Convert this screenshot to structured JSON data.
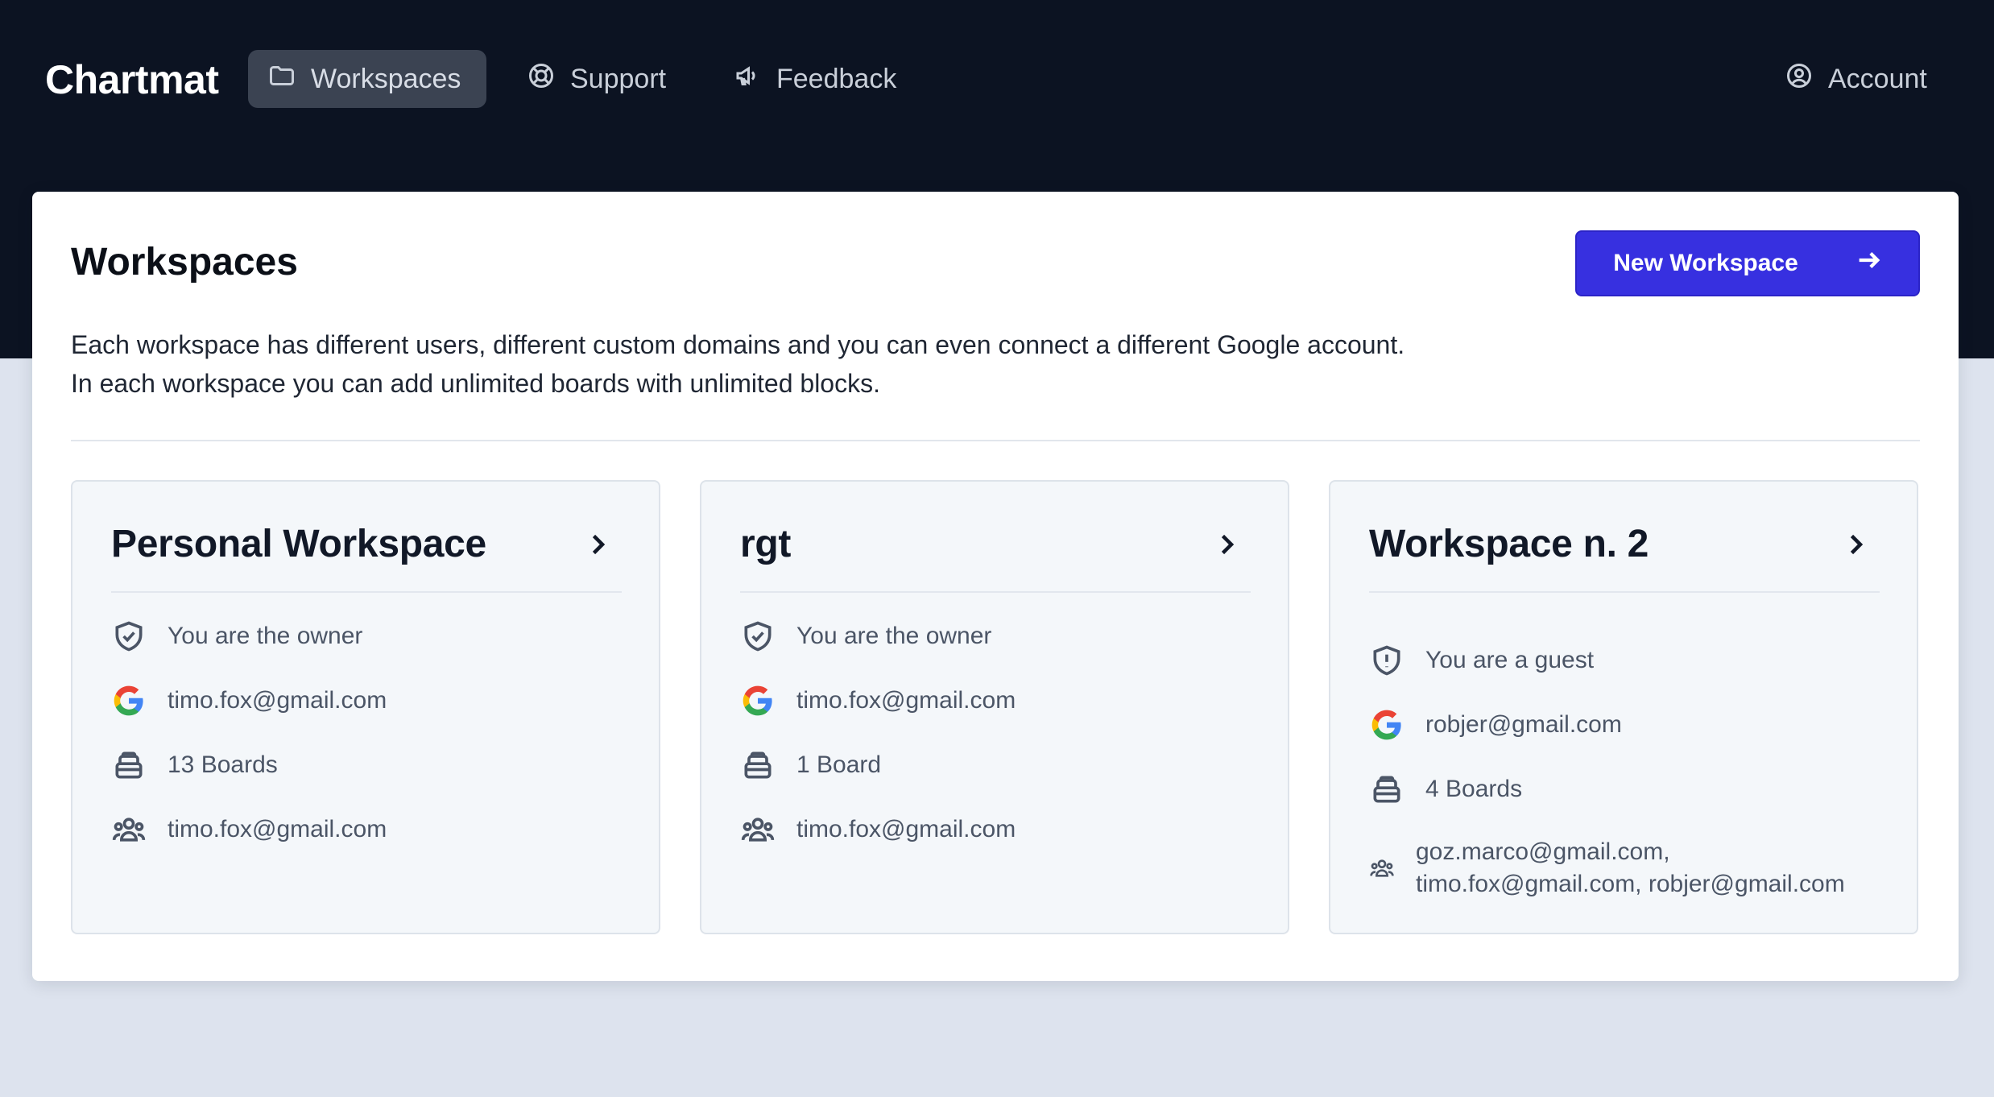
{
  "brand": "Chartmat",
  "nav": {
    "workspaces": "Workspaces",
    "support": "Support",
    "feedback": "Feedback",
    "account": "Account"
  },
  "panel": {
    "title": "Workspaces",
    "new_button": "New Workspace",
    "description_line1": "Each workspace has different users, different custom domains and you can even connect a different Google account.",
    "description_line2": "In each workspace you can add unlimited boards with unlimited blocks."
  },
  "cards": [
    {
      "title": "Personal Workspace",
      "role": "You are the owner",
      "google": "timo.fox@gmail.com",
      "boards": "13 Boards",
      "members_line1": "timo.fox@gmail.com"
    },
    {
      "title": "rgt",
      "role": "You are the owner",
      "google": "timo.fox@gmail.com",
      "boards": "1 Board",
      "members_line1": "timo.fox@gmail.com"
    },
    {
      "title": "Workspace n. 2",
      "role": "You are a guest",
      "google": "robjer@gmail.com",
      "boards": "4 Boards",
      "members_line1": "goz.marco@gmail.com,",
      "members_line2": "timo.fox@gmail.com, robjer@gmail.com"
    }
  ],
  "colors": {
    "header_bg": "#0c1322",
    "page_bg": "#dde3ee",
    "accent": "#3730e0",
    "card_bg": "#f4f7fa"
  },
  "icons": {
    "workspaces": "folder-icon",
    "support": "lifebuoy-icon",
    "feedback": "megaphone-icon",
    "account": "user-circle-icon",
    "owner": "shield-check-icon",
    "guest": "shield-exclamation-icon",
    "google": "google-icon",
    "boards": "inbox-stack-icon",
    "members": "user-group-icon"
  }
}
